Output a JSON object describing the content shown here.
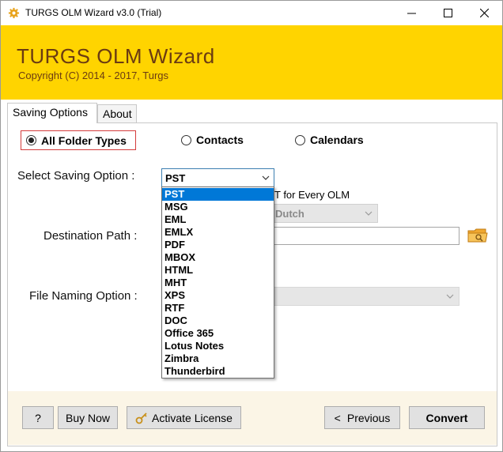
{
  "window": {
    "title": "TURGS OLM Wizard v3.0 (Trial)"
  },
  "banner": {
    "app_name": "TURGS OLM Wizard",
    "copyright": "Copyright (C) 2014 - 2017, Turgs"
  },
  "tabs": [
    {
      "label": "Saving Options",
      "active": true
    },
    {
      "label": "About",
      "active": false
    }
  ],
  "folder_types": {
    "all": "All Folder Types",
    "contacts": "Contacts",
    "calendars": "Calendars",
    "selected": "All Folder Types"
  },
  "saving_option": {
    "label": "Select Saving Option :",
    "value": "PST",
    "options": [
      "PST",
      "MSG",
      "EML",
      "EMLX",
      "PDF",
      "MBOX",
      "HTML",
      "MHT",
      "XPS",
      "RTF",
      "DOC",
      "Office 365",
      "Lotus Notes",
      "Zimbra",
      "Thunderbird"
    ],
    "selected_index": 0
  },
  "hidden_behind": {
    "checkbox_text_partial": "T for Every OLM",
    "language_value_partial": "Dutch"
  },
  "destination": {
    "label": "Destination Path :",
    "value": ""
  },
  "file_naming": {
    "label": "File Naming Option :",
    "value": ""
  },
  "buttons": {
    "help": "?",
    "buy_now": "Buy Now",
    "activate_license": "Activate License",
    "previous": "Previous",
    "convert": "Convert"
  },
  "colors": {
    "banner_bg": "#ffd400",
    "banner_text": "#6b3b12",
    "selection": "#0078d7",
    "footer_bg": "#fbf5e6"
  }
}
